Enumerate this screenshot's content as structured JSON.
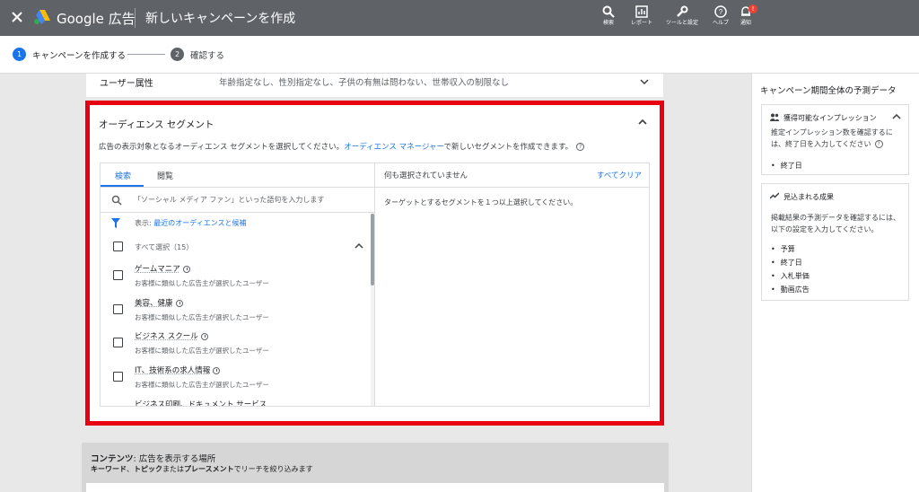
{
  "topbar": {
    "brand": "Google 広告",
    "title": "新しいキャンペーンを作成",
    "buttons": [
      {
        "label": "検索",
        "icon": "search-icon"
      },
      {
        "label": "レポート",
        "icon": "report-icon"
      },
      {
        "label": "ツールと設定",
        "icon": "wrench-icon"
      },
      {
        "label": "ヘルプ",
        "icon": "help-icon"
      },
      {
        "label": "通知",
        "icon": "bell-icon"
      }
    ],
    "notification_badge": "!"
  },
  "stepper": {
    "steps": [
      {
        "num": "1",
        "label": "キャンペーンを作成する",
        "active": true
      },
      {
        "num": "2",
        "label": "確認する",
        "active": false
      }
    ]
  },
  "user_attributes": {
    "label": "ユーザー属性",
    "value": "年齢指定なし、性別指定なし、子供の有無は問わない、世帯収入の制限なし"
  },
  "audience": {
    "title": "オーディエンス セグメント",
    "desc_pre": "広告の表示対象となるオーディエンス セグメントを選択してください。",
    "desc_link": "オーディエンス マネージャー",
    "desc_post": "で新しいセグメントを作成できます。",
    "tabs": [
      "検索",
      "閲覧"
    ],
    "search_placeholder": "「ソーシャル メディア ファン」といった語句を入力します",
    "filter_prefix": "表示:",
    "filter_value": "最近のオーディエンスと候補",
    "select_all": "すべて選択（15）",
    "items": [
      {
        "name": "ゲームマニア",
        "sub": "お客様に類似した広告主が選択したユーザー"
      },
      {
        "name": "美容、健康",
        "sub": "お客様に類似した広告主が選択したユーザー"
      },
      {
        "name": "ビジネス スクール",
        "sub": "お客様に類似した広告主が選択したユーザー"
      },
      {
        "name": "IT、技術系の求人情報",
        "sub": "お客様に類似した広告主が選択したユーザー"
      },
      {
        "name": "ビジネス印刷、ドキュメント サービス",
        "sub": ""
      }
    ],
    "selected_header": "何も選択されていません",
    "clear_all": "すべてクリア",
    "empty_message": "ターゲットとするセグメントを１つ以上選択してください。"
  },
  "content": {
    "title_bold": "コンテンツ",
    "title_rest": ": 広告を表示する場所",
    "sub_k1": "キーワード",
    "sub_sep1": "、",
    "sub_k2": "トピック",
    "sub_sep2": "または",
    "sub_k3": "プレースメント",
    "sub_rest": "でリーチを絞り込みます"
  },
  "sidebar": {
    "title": "キャンペーン期間全体の予測データ",
    "card1": {
      "heading": "獲得可能なインプレッション",
      "desc": "推定インプレッション数を確認するには、終了日を入力してください",
      "items": [
        "終了日"
      ]
    },
    "card2": {
      "heading": "見込まれる成果",
      "desc": "掲載結果の予測データを確認するには、以下の設定を入力してください。",
      "items": [
        "予算",
        "終了日",
        "入札単価",
        "動画広告"
      ]
    }
  },
  "colors": {
    "topbar": "#5f6368",
    "accent": "#1a73e8",
    "highlight": "#e60012"
  }
}
